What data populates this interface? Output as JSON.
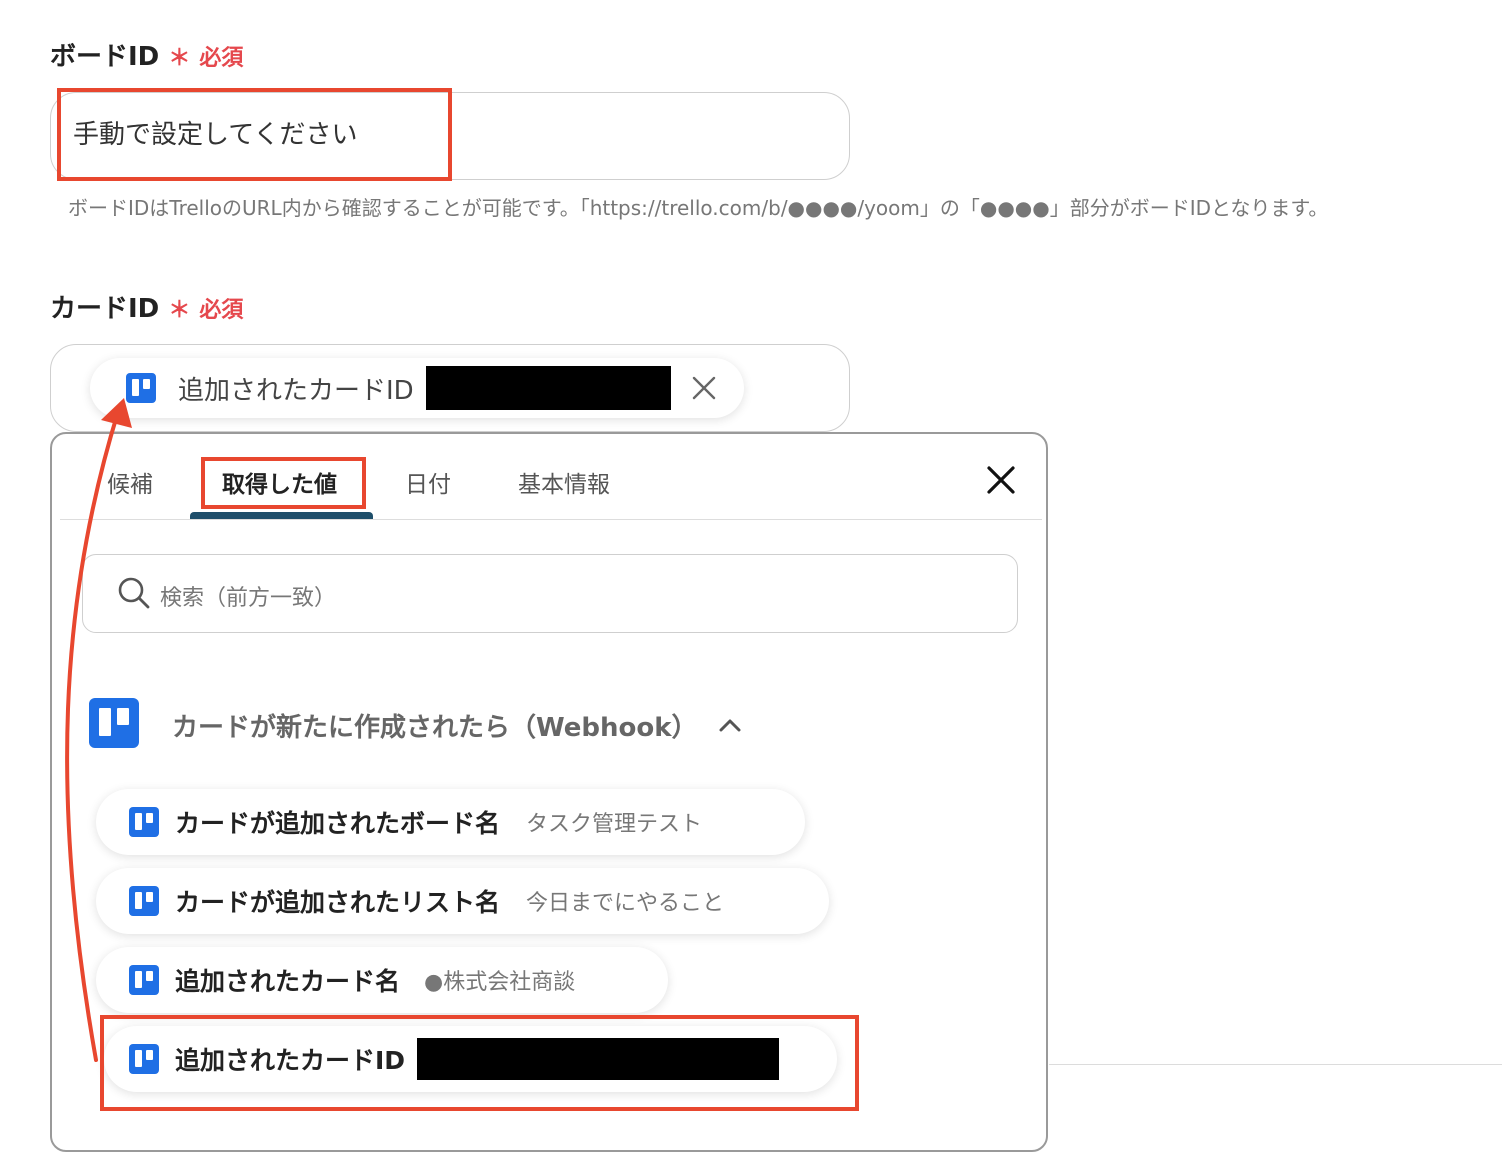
{
  "board_field": {
    "label": "ボードID",
    "required_mark": "＊",
    "required_text": "必須",
    "value": "手動で設定してください",
    "hint": "ボードIDはTrelloのURL内から確認することが可能です。「https://trello.com/b/●●●●/yoom」の「●●●●」部分がボードIDとなります。"
  },
  "card_field": {
    "label": "カードID",
    "required_mark": "＊",
    "required_text": "必須",
    "chip_label": "追加されたカードID"
  },
  "popup": {
    "tabs": [
      {
        "label": "候補"
      },
      {
        "label": "取得した値",
        "active": true
      },
      {
        "label": "日付"
      },
      {
        "label": "基本情報"
      }
    ],
    "search_placeholder": "検索（前方一致）",
    "group_title": "カードが新たに作成されたら（Webhook）",
    "items": [
      {
        "label": "カードが追加されたボード名",
        "value": "タスク管理テスト"
      },
      {
        "label": "カードが追加されたリスト名",
        "value": "今日までにやること"
      },
      {
        "label": "追加されたカード名",
        "value": "●株式会社商談"
      },
      {
        "label": "追加されたカードID",
        "value": ""
      }
    ]
  },
  "colors": {
    "required": "#e5484d",
    "highlight_box": "#e8472f",
    "trello_blue": "#1f6fe5",
    "tab_underline": "#1e4e6a"
  },
  "icons": [
    "trello-icon",
    "close-icon",
    "search-icon",
    "chevron-up-icon",
    "arrow-annotation"
  ]
}
